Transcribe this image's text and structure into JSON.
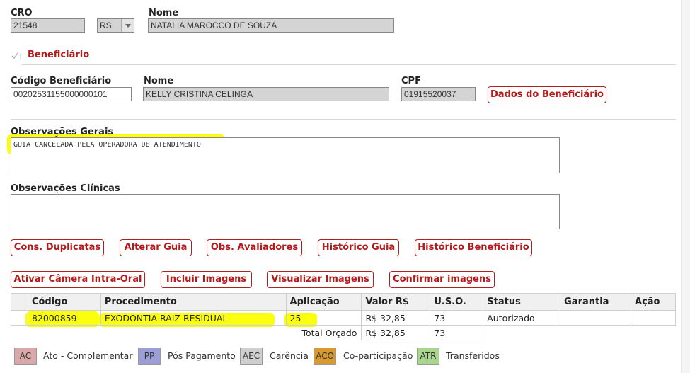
{
  "profissional": {
    "cro_label": "CRO",
    "cro_value": "21548",
    "uf_value": "RS",
    "nome_label": "Nome",
    "nome_value": "NATALIA MAROCCO DE SOUZA"
  },
  "beneficiario": {
    "section_title": "Beneficiário",
    "codigo_label": "Código Beneficiário",
    "codigo_value": "00202531155000000101",
    "nome_label": "Nome",
    "nome_value": "KELLY CRISTINA CELINGA",
    "cpf_label": "CPF",
    "cpf_value": "01915520037",
    "dados_button": "Dados do Beneficiário"
  },
  "observacoes": {
    "gerais_label": "Observações Gerais",
    "gerais_value": "GUIA CANCELADA PELA OPERADORA DE ATENDIMENTO",
    "clinicas_label": "Observações Clínicas",
    "clinicas_value": ""
  },
  "actions_row1": [
    "Cons. Duplicatas",
    "Alterar Guia",
    "Obs. Avaliadores",
    "Histórico Guia",
    "Histórico Beneficiário"
  ],
  "actions_row2": [
    "Ativar Câmera Intra-Oral",
    "Incluir Imagens",
    "Visualizar Imagens",
    "Confirmar imagens"
  ],
  "table": {
    "headers": [
      "Código",
      "Procedimento",
      "Aplicação",
      "Valor R$",
      "U.S.O.",
      "Status",
      "Garantia",
      "Ação"
    ],
    "rows": [
      [
        "82000859",
        "EXODONTIA RAIZ RESIDUAL",
        "25",
        "R$ 32,85",
        "73",
        "Autorizado",
        "",
        ""
      ]
    ],
    "total_label": "Total Orçado",
    "total_valor": "R$ 32,85",
    "total_uso": "73"
  },
  "legend": [
    {
      "code": "AC",
      "label": "Ato - Complementar",
      "color": "#d9a8a8"
    },
    {
      "code": "PP",
      "label": "Pós Pagamento",
      "color": "#9e9ed6"
    },
    {
      "code": "AEC",
      "label": "Carência",
      "color": "#cfcfcf"
    },
    {
      "code": "ACO",
      "label": "Co-participação",
      "color": "#d69a2e"
    },
    {
      "code": "ATR",
      "label": "Transferidos",
      "color": "#a8d68f"
    }
  ],
  "colors": {
    "accent": "#b31b1b",
    "highlight": "#fbff0d",
    "readonly_bg": "#d4d4d4"
  },
  "icons": {
    "collapse": "check-chevron-icon",
    "dropdown": "chevron-down-icon"
  }
}
